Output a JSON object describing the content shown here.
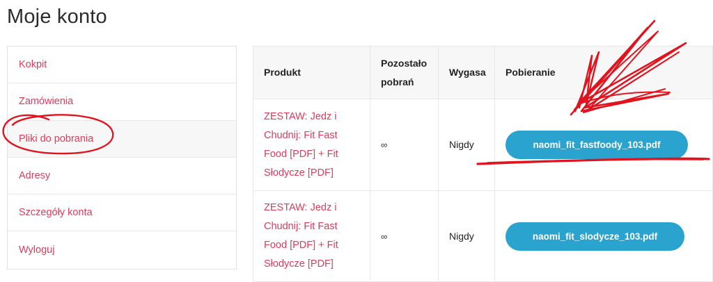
{
  "page": {
    "title": "Moje konto"
  },
  "sidebar": {
    "items": [
      {
        "label": "Kokpit"
      },
      {
        "label": "Zamówienia"
      },
      {
        "label": "Pliki do pobrania"
      },
      {
        "label": "Adresy"
      },
      {
        "label": "Szczegóły konta"
      },
      {
        "label": "Wyloguj"
      }
    ]
  },
  "table": {
    "headers": {
      "product": "Produkt",
      "remaining": "Pozostało pobrań",
      "expires": "Wygasa",
      "download": "Pobieranie"
    },
    "rows": [
      {
        "product": "ZESTAW: Jedz i Chudnij: Fit Fast Food [PDF] + Fit Słodycze [PDF]",
        "remaining": "∞",
        "expires": "Nigdy",
        "file": "naomi_fit_fastfoody_103.pdf"
      },
      {
        "product": "ZESTAW: Jedz i Chudnij: Fit Fast Food [PDF] + Fit Słodycze [PDF]",
        "remaining": "∞",
        "expires": "Nigdy",
        "file": "naomi_fit_slodycze_103.pdf"
      }
    ]
  },
  "colors": {
    "link": "#e03a5a",
    "button": "#2aa3cf",
    "annotation": "#e0141e"
  },
  "icons": {
    "scribble": "red-hand-drawn-arrow-annotation"
  }
}
